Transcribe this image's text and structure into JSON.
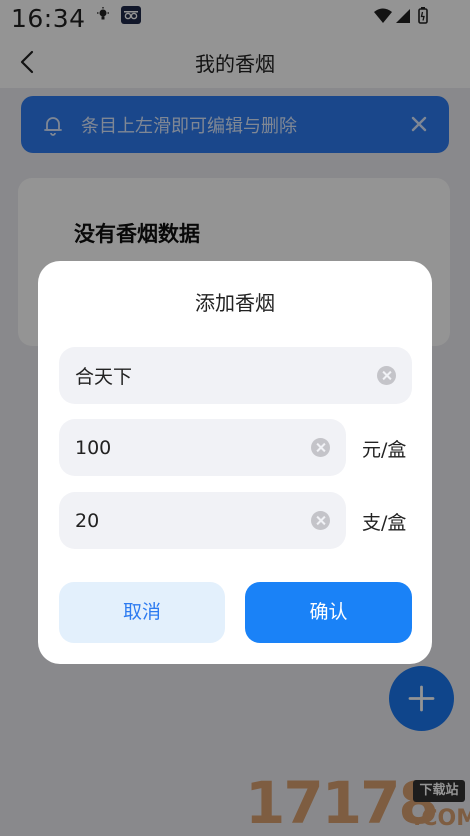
{
  "status_bar": {
    "time": "16:34"
  },
  "title_bar": {
    "title": "我的香烟"
  },
  "hint": {
    "text": "条目上左滑即可编辑与删除"
  },
  "empty_state": {
    "text": "没有香烟数据"
  },
  "dialog": {
    "title": "添加香烟",
    "name_value": "合天下",
    "price_value": "100",
    "price_unit": "元/盒",
    "count_value": "20",
    "count_unit": "支/盒",
    "cancel_label": "取消",
    "confirm_label": "确认"
  },
  "watermark": {
    "digits": "17178",
    "badge": "下载站",
    "suffix": ".COM"
  },
  "colors": {
    "accent": "#1a82f7",
    "banner": "#2d7bf0",
    "cancel_bg": "#e3f0fc",
    "field_bg": "#f1f2f6"
  }
}
